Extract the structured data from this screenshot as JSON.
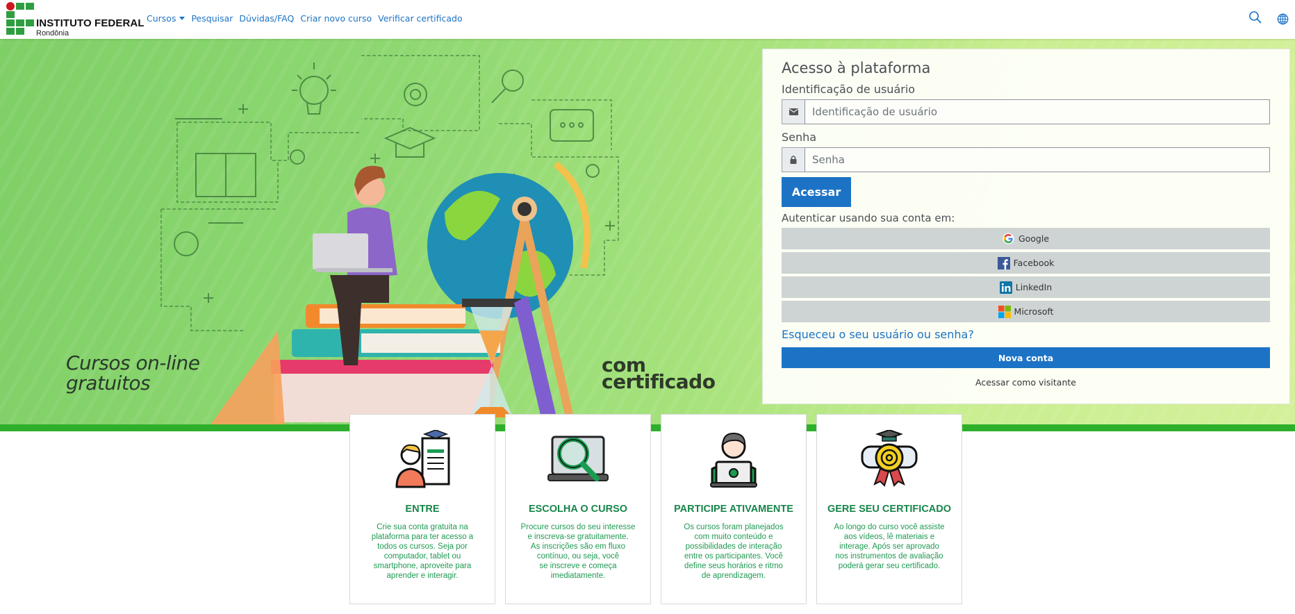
{
  "brand": {
    "title": "INSTITUTO FEDERAL",
    "subtitle": "Rondônia",
    "colors": {
      "green": "#2f9e41",
      "red": "#cd191e"
    }
  },
  "nav": {
    "links": [
      {
        "label": "Cursos",
        "has_dropdown": true
      },
      {
        "label": "Pesquisar"
      },
      {
        "label": "Dúvidas/FAQ"
      },
      {
        "label": "Criar novo curso"
      },
      {
        "label": "Verificar certificado"
      }
    ],
    "icons": [
      "search-icon",
      "globe-icon"
    ],
    "link_color": "#1c73c5"
  },
  "hero": {
    "text_left_line1": "Cursos on-line",
    "text_left_line2": "gratuitos",
    "text_right_line1": "com",
    "text_right_line2": "certificado"
  },
  "login": {
    "title": "Acesso à plataforma",
    "username_label": "Identificação de usuário",
    "username_placeholder": "Identificação de usuário",
    "username_value": "",
    "password_label": "Senha",
    "password_placeholder": "Senha",
    "password_value": "",
    "submit_label": "Acessar",
    "auth_label": "Autenticar usando sua conta em:",
    "providers": [
      {
        "name": "Google",
        "icon": "google-icon"
      },
      {
        "name": "Facebook",
        "icon": "facebook-icon"
      },
      {
        "name": "LinkedIn",
        "icon": "linkedin-icon"
      },
      {
        "name": "Microsoft",
        "icon": "microsoft-icon"
      }
    ],
    "forgot_label": "Esqueceu o seu usuário ou senha?",
    "new_account_label": "Nova conta",
    "guest_label": "Acessar como visitante",
    "primary_color": "#1c73c5"
  },
  "features": [
    {
      "title": "ENTRE",
      "icon": "student-certificate-icon",
      "lines": [
        "Crie sua conta gratuita na",
        "plataforma para ter acesso a",
        "todos os cursos. Seja por",
        "computador, tablet ou",
        "smartphone, aproveite para",
        "aprender e interagir."
      ]
    },
    {
      "title": "ESCOLHA O CURSO",
      "icon": "laptop-magnifier-icon",
      "lines": [
        "Procure cursos do seu interesse",
        "e inscreva-se gratuitamente.",
        "As inscrições são em fluxo",
        "contínuo, ou seja, você",
        "se inscreve e começa",
        "imediatamente."
      ]
    },
    {
      "title": "PARTICIPE ATIVAMENTE",
      "icon": "person-laptop-icon",
      "lines": [
        "Os cursos foram planejados",
        "com muito conteúdo e",
        "possibilidades de interação",
        "entre os participantes. Você",
        "define seus horários e ritmo",
        "de aprendizagem."
      ]
    },
    {
      "title": "GERE SEU CERTIFICADO",
      "icon": "certificate-badge-icon",
      "lines": [
        "Ao longo do curso você assiste",
        "aos vídeos, lê materiais e",
        "interage. Após ser aprovado",
        "nos instrumentos de avaliação",
        "poderá gerar seu certificado."
      ]
    }
  ]
}
